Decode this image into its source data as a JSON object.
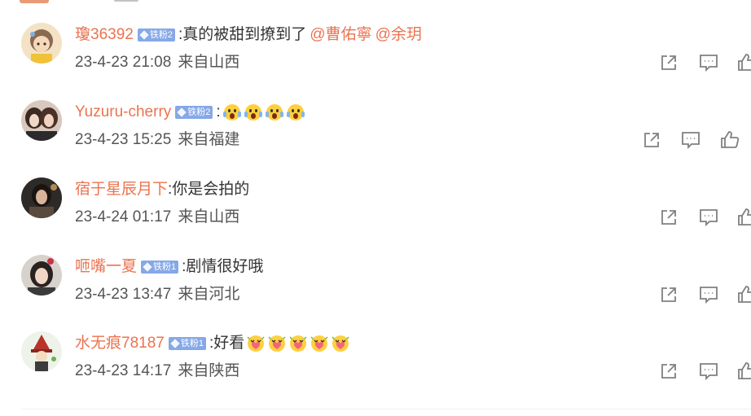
{
  "colors": {
    "username": "#eb7350",
    "text": "#333333",
    "meta": "#555555",
    "badge_bg": "#86a8e7",
    "icon": "#808080"
  },
  "comments": [
    {
      "username": "瓊36392",
      "badge": "铁粉2",
      "colon": ":",
      "text": "真的被甜到撩到了",
      "mentions": [
        "@曹佑寧",
        "@余玥"
      ],
      "emoji_count": 0,
      "timestamp": "23-4-23 21:08",
      "source": "来自山西",
      "avatar_desc": "cartoon-avatar"
    },
    {
      "username": "Yuzuru-cherry",
      "badge": "铁粉2",
      "colon": ":",
      "text": "",
      "mentions": [],
      "emoji_count": 4,
      "emoji_name": "scream-emoji",
      "timestamp": "23-4-23 15:25",
      "source": "来自福建",
      "avatar_desc": "photo-avatar"
    },
    {
      "username": "宿于星辰月下",
      "badge": "",
      "colon": ":",
      "text": "你是会拍的",
      "mentions": [],
      "emoji_count": 0,
      "timestamp": "23-4-24 01:17",
      "source": "来自山西",
      "avatar_desc": "photo-avatar"
    },
    {
      "username": "咂嘴一夏",
      "badge": "铁粉1",
      "colon": ":",
      "text": "剧情很好哦",
      "mentions": [],
      "emoji_count": 0,
      "timestamp": "23-4-23 13:47",
      "source": "来自河北",
      "avatar_desc": "photo-avatar"
    },
    {
      "username": "水无痕78187",
      "badge": "铁粉1",
      "colon": ":",
      "text": "好看",
      "mentions": [],
      "emoji_count": 5,
      "emoji_name": "love-emoji",
      "timestamp": "23-4-23 14:17",
      "source": "来自陕西",
      "avatar_desc": "cartoon-avatar"
    }
  ],
  "action_icons": [
    "share-icon",
    "comment-icon",
    "like-icon"
  ]
}
